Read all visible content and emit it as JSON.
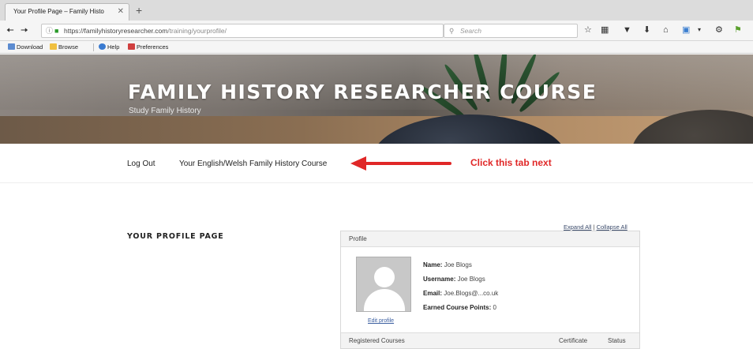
{
  "browser": {
    "tab_title": "Your Profile Page – Family Histo",
    "tab_close": "✕",
    "new_tab": "+",
    "url_host": "https://familyhistoryresearcher.com",
    "url_path": "/training/yourprofile/",
    "search_placeholder": "Search",
    "icons": [
      "back-icon",
      "forward-icon",
      "info-icon",
      "lock-icon",
      "reload-icon",
      "search-icon",
      "star-icon",
      "reading-list-icon",
      "pocket-icon",
      "download-icon",
      "home-icon",
      "screenshot-icon",
      "menu-icon",
      "extension-icon",
      "notification-icon"
    ]
  },
  "bookmarks": {
    "items": [
      {
        "label": "Download",
        "icon": "download-bookmark-icon",
        "color": "#5b8bd0"
      },
      {
        "label": "Browse",
        "icon": "browse-bookmark-icon",
        "color": "#f0c040"
      },
      {
        "label": "Help",
        "icon": "help-bookmark-icon",
        "color": "#3a7ad0"
      },
      {
        "label": "Preferences",
        "icon": "preferences-bookmark-icon",
        "color": "#d04040"
      }
    ]
  },
  "hero": {
    "title": "FAMILY HISTORY RESEARCHER COURSE",
    "subtitle": "Study Family History"
  },
  "nav": {
    "logout_label": "Log Out",
    "course_label": "Your English/Welsh Family History Course"
  },
  "annotation": {
    "callout_text": "Click this tab next",
    "color": "#e02727"
  },
  "profile": {
    "section_title": "YOUR PROFILE PAGE",
    "expand_all": "Expand All",
    "separator": "|",
    "collapse_all": "Collapse All",
    "panel_title": "Profile",
    "edit_profile": "Edit profile",
    "fields": [
      {
        "label": "Name:",
        "value": "Joe Blogs"
      },
      {
        "label": "Username:",
        "value": "Joe Blogs"
      },
      {
        "label": "Email:",
        "value": "Joe.Blogs@...co.uk"
      },
      {
        "label": "Earned Course Points:",
        "value": "0"
      }
    ],
    "courses_header": {
      "registered": "Registered Courses",
      "certificate": "Certificate",
      "status": "Status"
    }
  }
}
